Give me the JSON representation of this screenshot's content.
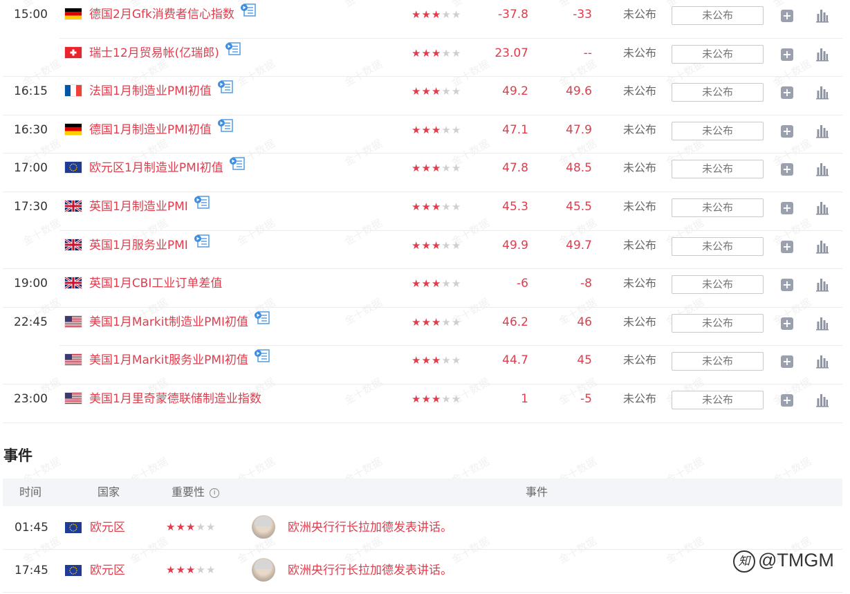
{
  "calendar": {
    "rows": [
      {
        "time": "15:00",
        "flag": "de",
        "name": "德国2月Gfk消费者信心指数",
        "video": true,
        "stars": 3,
        "prev": "-37.8",
        "forecast": "-33",
        "actual": "未公布",
        "predict_placeholder": "未公布"
      },
      {
        "time": "",
        "flag": "ch",
        "name": "瑞士12月贸易帐(亿瑞郎)",
        "video": true,
        "stars": 3,
        "prev": "23.07",
        "forecast": "--",
        "actual": "未公布",
        "predict_placeholder": "未公布"
      },
      {
        "time": "16:15",
        "flag": "fr",
        "name": "法国1月制造业PMI初值",
        "video": true,
        "stars": 3,
        "prev": "49.2",
        "forecast": "49.6",
        "actual": "未公布",
        "predict_placeholder": "未公布"
      },
      {
        "time": "16:30",
        "flag": "de",
        "name": "德国1月制造业PMI初值",
        "video": true,
        "stars": 3,
        "prev": "47.1",
        "forecast": "47.9",
        "actual": "未公布",
        "predict_placeholder": "未公布"
      },
      {
        "time": "17:00",
        "flag": "eu",
        "name": "欧元区1月制造业PMI初值",
        "video": true,
        "stars": 3,
        "prev": "47.8",
        "forecast": "48.5",
        "actual": "未公布",
        "predict_placeholder": "未公布"
      },
      {
        "time": "17:30",
        "flag": "gb",
        "name": "英国1月制造业PMI",
        "video": true,
        "stars": 3,
        "prev": "45.3",
        "forecast": "45.5",
        "actual": "未公布",
        "predict_placeholder": "未公布"
      },
      {
        "time": "",
        "flag": "gb",
        "name": "英国1月服务业PMI",
        "video": true,
        "stars": 3,
        "prev": "49.9",
        "forecast": "49.7",
        "actual": "未公布",
        "predict_placeholder": "未公布"
      },
      {
        "time": "19:00",
        "flag": "gb",
        "name": "英国1月CBI工业订单差值",
        "video": false,
        "stars": 3,
        "prev": "-6",
        "forecast": "-8",
        "actual": "未公布",
        "predict_placeholder": "未公布"
      },
      {
        "time": "22:45",
        "flag": "us",
        "name": "美国1月Markit制造业PMI初值",
        "video": true,
        "stars": 3,
        "prev": "46.2",
        "forecast": "46",
        "actual": "未公布",
        "predict_placeholder": "未公布"
      },
      {
        "time": "",
        "flag": "us",
        "name": "美国1月Markit服务业PMI初值",
        "video": true,
        "stars": 3,
        "prev": "44.7",
        "forecast": "45",
        "actual": "未公布",
        "predict_placeholder": "未公布"
      },
      {
        "time": "23:00",
        "flag": "us",
        "name": "美国1月里奇蒙德联储制造业指数",
        "video": false,
        "stars": 3,
        "prev": "1",
        "forecast": "-5",
        "actual": "未公布",
        "predict_placeholder": "未公布"
      }
    ]
  },
  "events": {
    "title": "事件",
    "header": {
      "time": "时间",
      "country": "国家",
      "importance": "重要性",
      "event": "事件"
    },
    "rows": [
      {
        "time": "01:45",
        "flag": "eu",
        "country": "欧元区",
        "stars": 3,
        "desc": "欧洲央行行长拉加德发表讲话。"
      },
      {
        "time": "17:45",
        "flag": "eu",
        "country": "欧元区",
        "stars": 3,
        "desc": "欧洲央行行长拉加德发表讲话。"
      }
    ]
  },
  "brand": {
    "text": "@TMGM",
    "glyph": "知"
  },
  "watermark": "金十数据",
  "colors": {
    "accent": "#e03c4c",
    "star_off": "#cfcfcf",
    "header_bg": "#f4f5f8"
  }
}
